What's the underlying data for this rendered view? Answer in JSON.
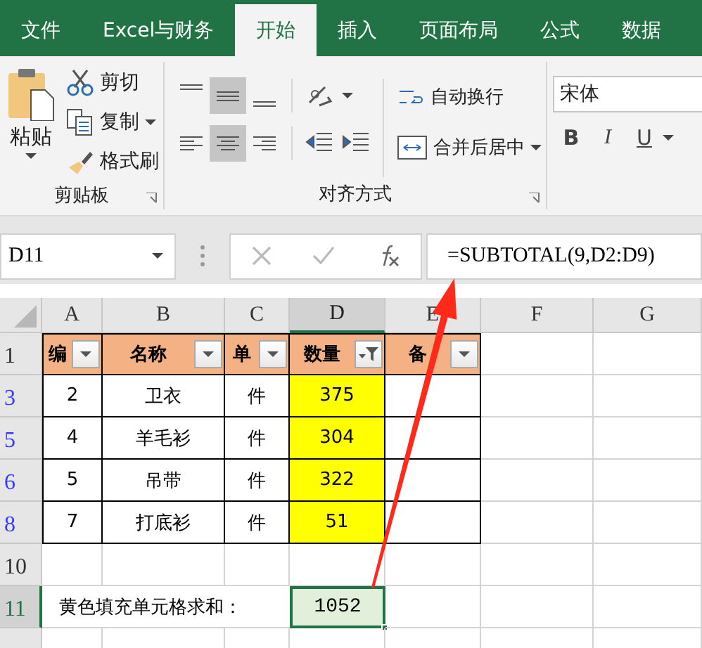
{
  "tabs": [
    {
      "label": "文件",
      "selected": false
    },
    {
      "label": "Excel与财务",
      "selected": false
    },
    {
      "label": "开始",
      "selected": true
    },
    {
      "label": "插入",
      "selected": false
    },
    {
      "label": "页面布局",
      "selected": false
    },
    {
      "label": "公式",
      "selected": false
    },
    {
      "label": "数据",
      "selected": false
    }
  ],
  "clipboard": {
    "paste": "粘贴",
    "cut": "剪切",
    "copy": "复制",
    "format_painter": "格式刷",
    "label": "剪贴板"
  },
  "alignment": {
    "vertical_align": [
      {
        "selected": false
      },
      {
        "selected": true
      },
      {
        "selected": false
      }
    ],
    "horizontal_align": [
      {
        "selected": false
      },
      {
        "selected": true
      },
      {
        "selected": false
      }
    ],
    "wrap_text": "自动换行",
    "merge_center": "合并后居中",
    "label": "对齐方式"
  },
  "font": {
    "name": "宋体",
    "buttons": [
      "B",
      "I",
      "U"
    ]
  },
  "formula_bar": {
    "name_box": "D11",
    "formula": "=SUBTOTAL(9,D2:D9)"
  },
  "columns": [
    {
      "label": "A",
      "selected": false
    },
    {
      "label": "B",
      "selected": false
    },
    {
      "label": "C",
      "selected": false
    },
    {
      "label": "D",
      "selected": true
    },
    {
      "label": "E",
      "selected": false
    },
    {
      "label": "F",
      "selected": false
    },
    {
      "label": "G",
      "selected": false
    }
  ],
  "rows": [
    {
      "number": "1",
      "kind": "header",
      "filtered": false,
      "selected": false,
      "cells": [
        {
          "text": "编",
          "filtered": false
        },
        {
          "text": "名称",
          "filtered": false
        },
        {
          "text": "单",
          "filtered": false
        },
        {
          "text": "数量",
          "filtered": true
        },
        {
          "text": "备",
          "filtered": false
        }
      ]
    },
    {
      "number": "3",
      "kind": "data",
      "filtered": true,
      "selected": false,
      "cells": [
        {
          "text": "2",
          "highlighted": false
        },
        {
          "text": "卫衣",
          "highlighted": false
        },
        {
          "text": "件",
          "highlighted": false
        },
        {
          "text": "375",
          "highlighted": true
        },
        {
          "highlighted": false
        }
      ]
    },
    {
      "number": "5",
      "kind": "data",
      "filtered": true,
      "selected": false,
      "cells": [
        {
          "text": "4",
          "highlighted": false
        },
        {
          "text": "羊毛衫",
          "highlighted": false
        },
        {
          "text": "件",
          "highlighted": false
        },
        {
          "text": "304",
          "highlighted": true
        },
        {
          "highlighted": false
        }
      ]
    },
    {
      "number": "6",
      "kind": "data",
      "filtered": true,
      "selected": false,
      "cells": [
        {
          "text": "5",
          "highlighted": false
        },
        {
          "text": "吊带",
          "highlighted": false
        },
        {
          "text": "件",
          "highlighted": false
        },
        {
          "text": "322",
          "highlighted": true
        },
        {
          "highlighted": false
        }
      ]
    },
    {
      "number": "8",
      "kind": "data",
      "filtered": true,
      "selected": false,
      "cells": [
        {
          "text": "7",
          "highlighted": false
        },
        {
          "text": "打底衫",
          "highlighted": false
        },
        {
          "text": "件",
          "highlighted": false
        },
        {
          "text": "51",
          "highlighted": true
        },
        {
          "highlighted": false
        }
      ]
    },
    {
      "number": "10",
      "kind": "blank",
      "filtered": false,
      "selected": false
    },
    {
      "number": "11",
      "kind": "summary",
      "filtered": false,
      "selected": true,
      "label": "黄色填充单元格求和：",
      "value": "1052"
    }
  ]
}
